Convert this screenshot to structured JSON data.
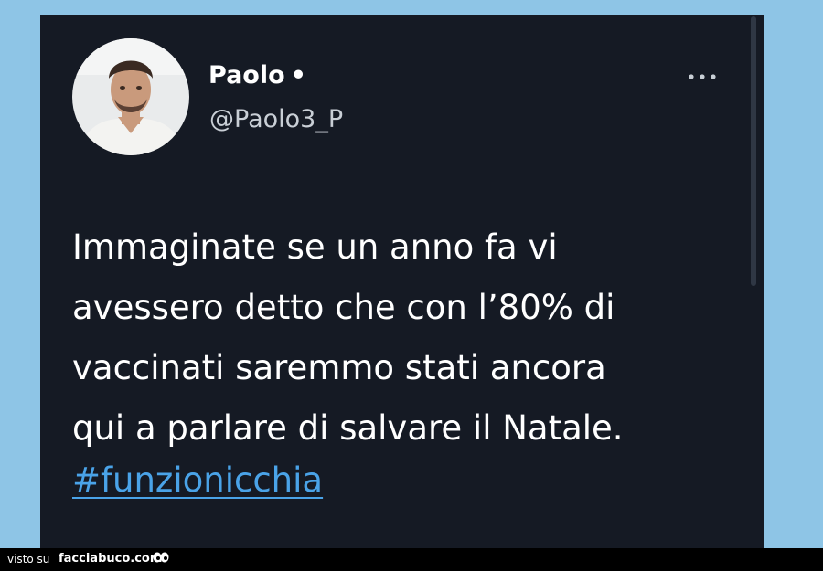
{
  "tweet": {
    "display_name": "Paolo",
    "name_separator": "•",
    "handle": "@Paolo3_P",
    "more_icon": "more-horizontal-icon",
    "text_lines": [
      "Immaginate se un anno fa vi",
      "avessero detto che con l’80% di",
      "vaccinati saremmo stati ancora",
      "qui a parlare di salvare il Natale."
    ],
    "hashtag": "#funzionicchia"
  },
  "footer": {
    "label": "visto su",
    "brand": "facciabuco.com",
    "logo_icon": "eyes-icon"
  },
  "colors": {
    "page_background": "#8ec5e6",
    "card_background": "#151a24",
    "text_primary": "#ffffff",
    "text_secondary": "#c9cfd6",
    "hashtag": "#4aa3e8",
    "footer_background": "#000000"
  }
}
